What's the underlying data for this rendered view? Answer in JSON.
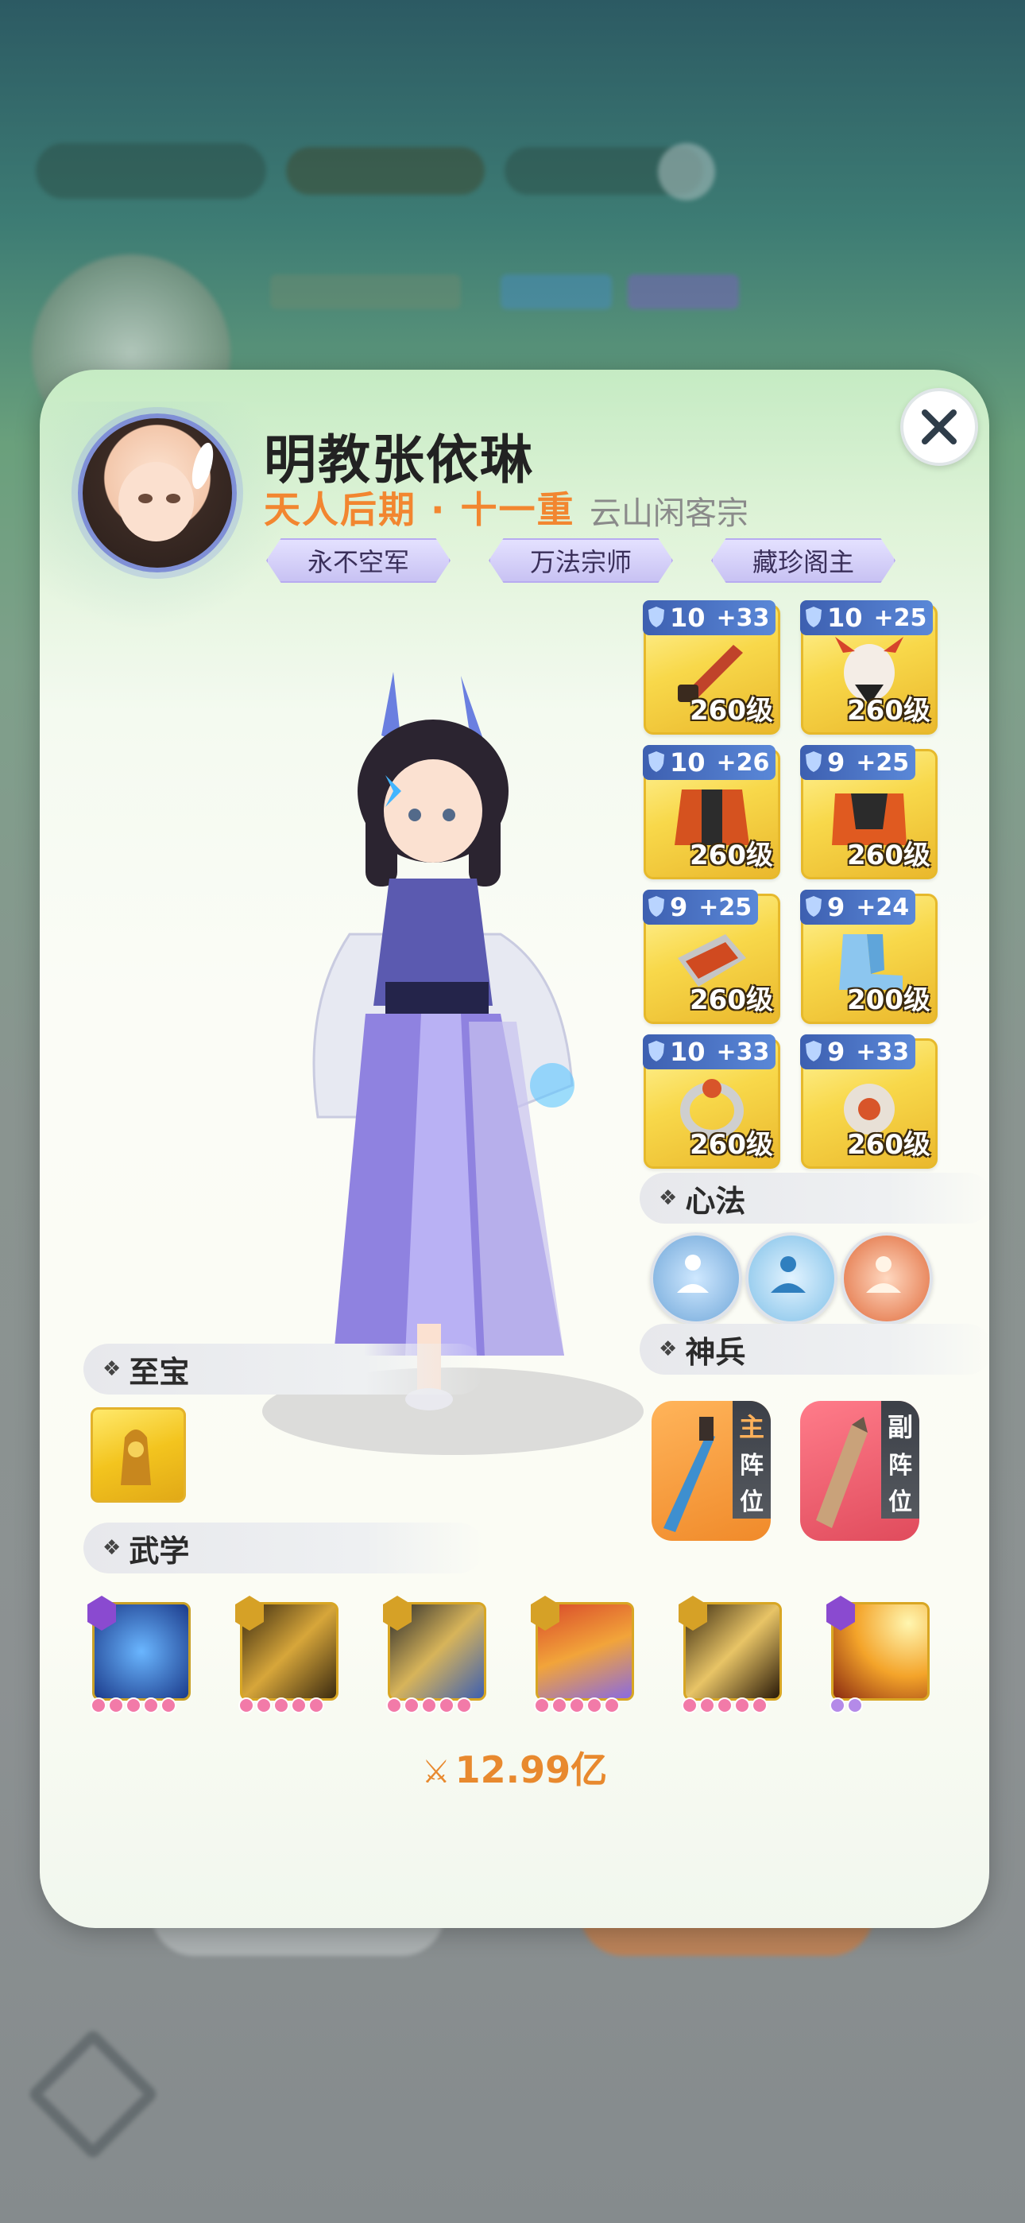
{
  "header": {
    "name": "明教张依琳",
    "realm": "天人后期 · 十一重",
    "sect": "云山闲客宗",
    "titles": [
      "永不空军",
      "万法宗师",
      "藏珍阁主"
    ]
  },
  "close_icon": "close-icon",
  "equipment": [
    {
      "tier": "10",
      "plus": "+33",
      "level": "260级",
      "icon": "saber-icon"
    },
    {
      "tier": "10",
      "plus": "+25",
      "level": "260级",
      "icon": "mask-helmet-icon"
    },
    {
      "tier": "10",
      "plus": "+26",
      "level": "260级",
      "icon": "armor-icon"
    },
    {
      "tier": "9",
      "plus": "+25",
      "level": "260级",
      "icon": "leg-armor-icon"
    },
    {
      "tier": "9",
      "plus": "+25",
      "level": "260级",
      "icon": "bracer-icon"
    },
    {
      "tier": "9",
      "plus": "+24",
      "level": "200级",
      "icon": "boots-icon"
    },
    {
      "tier": "10",
      "plus": "+33",
      "level": "260级",
      "icon": "ring-icon"
    },
    {
      "tier": "9",
      "plus": "+33",
      "level": "260级",
      "icon": "amulet-icon"
    }
  ],
  "sections": {
    "heart_method": "心法",
    "divine_weapon": "神兵",
    "treasure": "至宝",
    "martial": "武学"
  },
  "weapons": {
    "main": {
      "badge": "主",
      "text1": "阵",
      "text2": "位"
    },
    "sub": {
      "badge": "副",
      "text1": "阵",
      "text2": "位"
    }
  },
  "power": "12.99亿",
  "colors": {
    "accent_orange": "#f28630",
    "title_purple": "#c8c2f3",
    "equip_gold": "#f8d84a",
    "tier_blue": "#3d5fb0"
  }
}
